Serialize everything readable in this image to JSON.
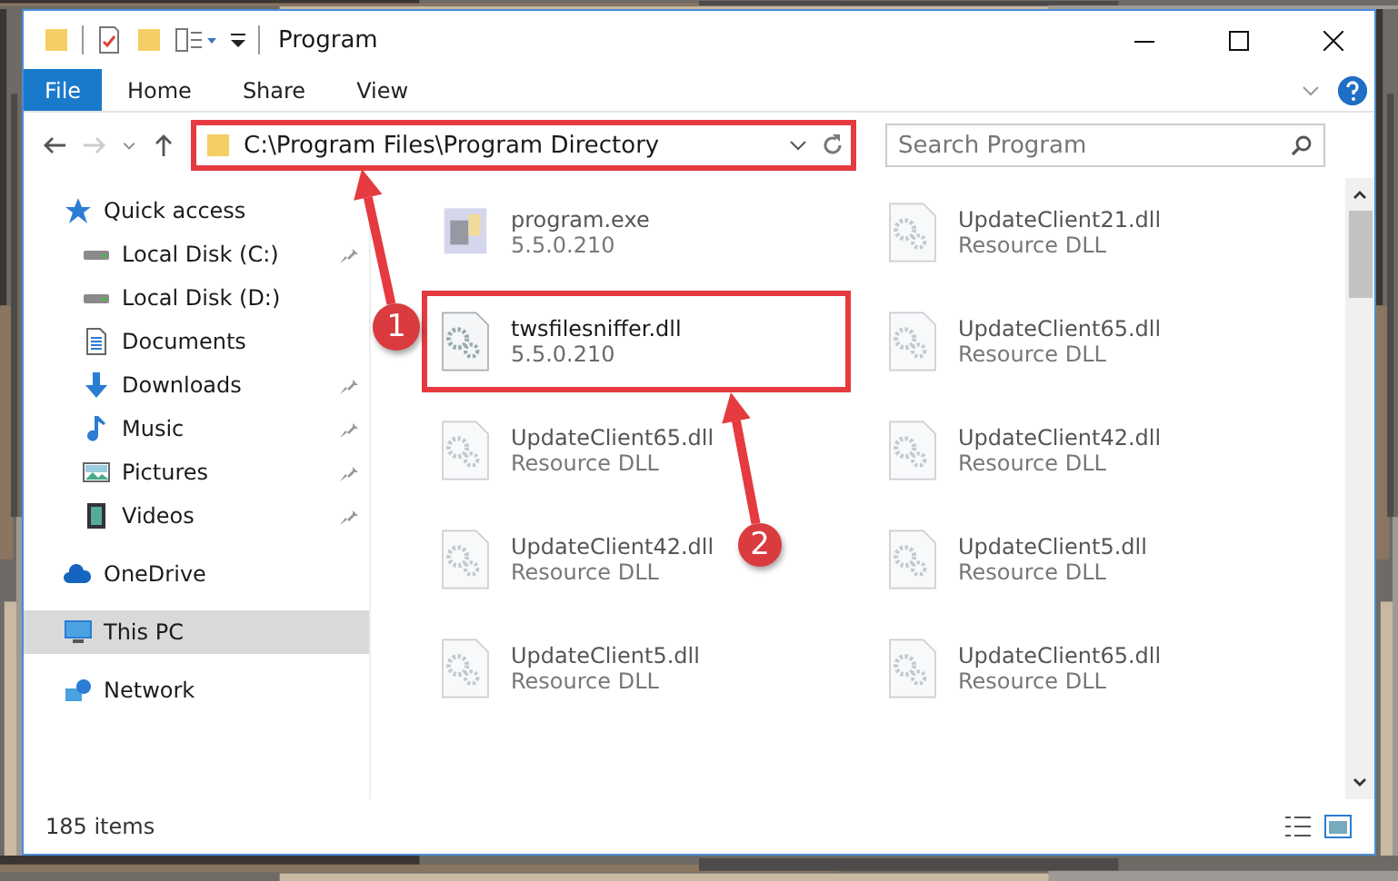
{
  "window": {
    "title": "Program"
  },
  "ribbon": {
    "file_tab": "File",
    "tabs": [
      "Home",
      "Share",
      "View"
    ]
  },
  "address": {
    "path": "C:\\Program Files\\Program Directory",
    "highlighted": true
  },
  "search": {
    "placeholder": "Search Program"
  },
  "nav": [
    {
      "label": "Quick access",
      "kind": "quick",
      "selected": false,
      "children": [
        {
          "label": "Local Disk (C:)",
          "kind": "drive",
          "pinned": true,
          "selected": false
        },
        {
          "label": "Local Disk (D:)",
          "kind": "drive",
          "pinned": false,
          "selected": false
        },
        {
          "label": "Documents",
          "kind": "documents",
          "pinned": false,
          "selected": false
        },
        {
          "label": "Downloads",
          "kind": "downloads",
          "pinned": true,
          "selected": false
        },
        {
          "label": "Music",
          "kind": "music",
          "pinned": true,
          "selected": false
        },
        {
          "label": "Pictures",
          "kind": "pictures",
          "pinned": true,
          "selected": false
        },
        {
          "label": "Videos",
          "kind": "videos",
          "pinned": true,
          "selected": false
        }
      ]
    },
    {
      "label": "OneDrive",
      "kind": "cloud",
      "selected": false
    },
    {
      "label": "This PC",
      "kind": "computer",
      "selected": true
    },
    {
      "label": "Network",
      "kind": "network",
      "selected": false
    }
  ],
  "files": [
    {
      "name": "program.exe",
      "detail": "5.5.0.210",
      "kind": "exe",
      "blurred": true,
      "highlighted": false
    },
    {
      "name": "UpdateClient21.dll",
      "detail": "Resource DLL",
      "kind": "dll",
      "blurred": true,
      "highlighted": false
    },
    {
      "name": "twsfilesniffer.dll",
      "detail": "5.5.0.210",
      "kind": "dll",
      "blurred": false,
      "highlighted": true
    },
    {
      "name": "UpdateClient65.dll",
      "detail": "Resource DLL",
      "kind": "dll",
      "blurred": true,
      "highlighted": false
    },
    {
      "name": "UpdateClient65.dll",
      "detail": "Resource DLL",
      "kind": "dll",
      "blurred": true,
      "highlighted": false
    },
    {
      "name": "UpdateClient42.dll",
      "detail": "Resource DLL",
      "kind": "dll",
      "blurred": true,
      "highlighted": false
    },
    {
      "name": "UpdateClient42.dll",
      "detail": "Resource DLL",
      "kind": "dll",
      "blurred": true,
      "highlighted": false
    },
    {
      "name": "UpdateClient5.dll",
      "detail": "Resource DLL",
      "kind": "dll",
      "blurred": true,
      "highlighted": false
    },
    {
      "name": "UpdateClient5.dll",
      "detail": "Resource DLL",
      "kind": "dll",
      "blurred": true,
      "highlighted": false
    },
    {
      "name": "UpdateClient65.dll",
      "detail": "Resource DLL",
      "kind": "dll",
      "blurred": true,
      "highlighted": false
    }
  ],
  "status_bar": {
    "count": "185 items"
  },
  "callouts": [
    {
      "number": "1"
    },
    {
      "number": "2"
    }
  ]
}
